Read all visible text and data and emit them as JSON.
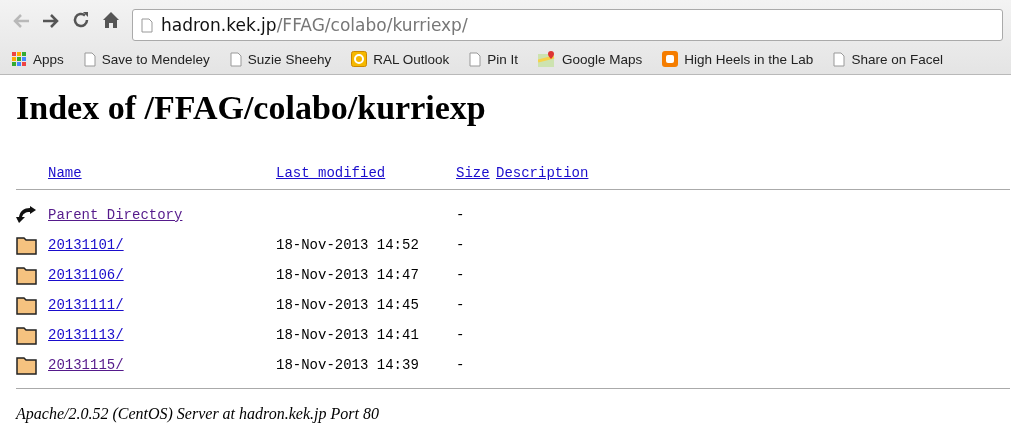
{
  "toolbar": {
    "back_disabled": true,
    "url_host": "hadron.kek.jp",
    "url_path": "/FFAG/colabo/kurriexp/"
  },
  "bookmarks": [
    {
      "kind": "apps",
      "label": "Apps"
    },
    {
      "kind": "page",
      "label": "Save to Mendeley"
    },
    {
      "kind": "page",
      "label": "Suzie Sheehy"
    },
    {
      "kind": "outlook",
      "label": "RAL Outlook"
    },
    {
      "kind": "page",
      "label": "Pin It"
    },
    {
      "kind": "maps",
      "label": "Google Maps"
    },
    {
      "kind": "blogger",
      "label": "High Heels in the Lab"
    },
    {
      "kind": "page",
      "label": "Share on Facel"
    }
  ],
  "page": {
    "title": "Index of /FFAG/colabo/kurriexp",
    "columns": [
      "Name",
      "Last modified",
      "Size",
      "Description"
    ],
    "rows": [
      {
        "kind": "parent",
        "name": "Parent Directory",
        "modified": "",
        "size": "-",
        "visited": true
      },
      {
        "kind": "folder",
        "name": "20131101/",
        "modified": "18-Nov-2013 14:52",
        "size": "-",
        "visited": false
      },
      {
        "kind": "folder",
        "name": "20131106/",
        "modified": "18-Nov-2013 14:47",
        "size": "-",
        "visited": false
      },
      {
        "kind": "folder",
        "name": "20131111/",
        "modified": "18-Nov-2013 14:45",
        "size": "-",
        "visited": false
      },
      {
        "kind": "folder",
        "name": "20131113/",
        "modified": "18-Nov-2013 14:41",
        "size": "-",
        "visited": false
      },
      {
        "kind": "folder",
        "name": "20131115/",
        "modified": "18-Nov-2013 14:39",
        "size": "-",
        "visited": true
      }
    ],
    "footer": "Apache/2.0.52 (CentOS) Server at hadron.kek.jp Port 80"
  }
}
